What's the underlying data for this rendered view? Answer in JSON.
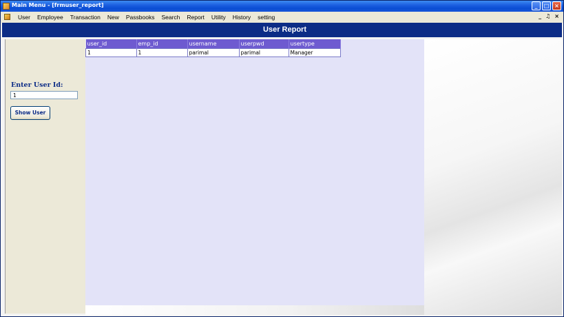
{
  "window": {
    "title": "Main Menu - [frmuser_report]",
    "minimize_glyph": "_",
    "maximize_glyph": "□",
    "close_glyph": "×"
  },
  "menu": {
    "items": [
      "User",
      "Employee",
      "Transaction",
      "New",
      "Passbooks",
      "Search",
      "Report",
      "Utility",
      "History",
      "setting"
    ],
    "mdi_controls": [
      "_",
      "♫",
      "×"
    ]
  },
  "header": {
    "title": "User Report"
  },
  "left_panel": {
    "label": "Enter User Id:",
    "input_value": "1",
    "button_label": "Show User"
  },
  "grid": {
    "columns": [
      "user_id",
      "emp_id",
      "username",
      "userpwd",
      "usertype"
    ],
    "rows": [
      [
        "1",
        "1",
        "parimal",
        "parimal",
        "Manager"
      ]
    ]
  },
  "colors": {
    "header_bg": "#0c2c86",
    "grid_header_bg": "#6e5bd0",
    "grid_area_bg": "#e3e3f8",
    "panel_bg": "#ece9d8"
  }
}
